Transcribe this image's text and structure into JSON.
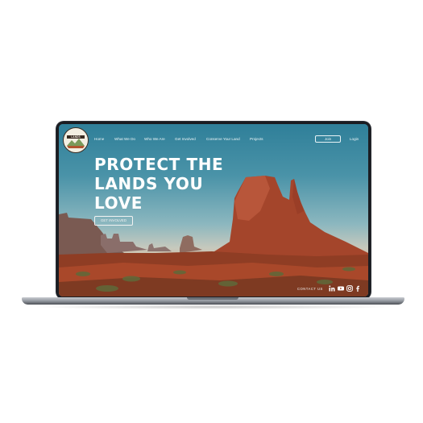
{
  "nav": {
    "logo_text": "AMERICAN LANDS",
    "links": [
      "Home",
      "What We Do",
      "Who We Are",
      "Get Involved",
      "Conserve Your Land",
      "Projects"
    ],
    "join_label": "Join",
    "login_label": "Login"
  },
  "hero": {
    "headline_line1": "PROTECT THE",
    "headline_line2": "LANDS YOU",
    "headline_line3": "LOVE",
    "cta_label": "GET INVOLVED"
  },
  "footer": {
    "contact_label": "CONTACT US",
    "social_icons": [
      "linkedin-icon",
      "youtube-icon",
      "instagram-icon",
      "facebook-icon"
    ]
  }
}
